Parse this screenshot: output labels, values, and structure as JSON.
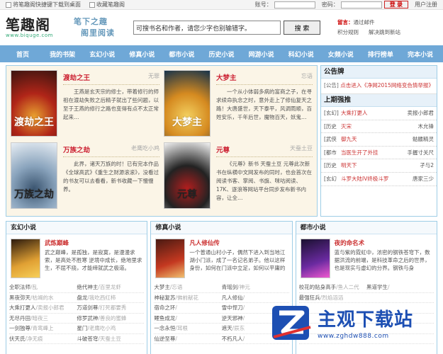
{
  "topbar": {
    "bookmark_text": "将笔趣阁快捷键下载到桌面",
    "favorite_text": "收藏笔趣阁",
    "account_label": "账号：",
    "password_label": "密码：",
    "login_label": "登 录",
    "user_register": "用户注册"
  },
  "header": {
    "logo_cn": "笔趣阁",
    "logo_en": "www.biquge.com",
    "slogan_line1": "笔下之趣",
    "slogan_line2": "阁里阅读",
    "search_value": "可搜书名和作者，请您少字也别输错字。",
    "search_button": "搜 索",
    "notice_label": "留言：",
    "notice_link": "通过邮件",
    "notice_link2": "积分规则",
    "notice_link3": "解决跳到新站"
  },
  "nav": [
    "首页",
    "我的书架",
    "玄幻小说",
    "修真小说",
    "都市小说",
    "历史小说",
    "网游小说",
    "科幻小说",
    "女频小说",
    "排行榜单",
    "完本小说"
  ],
  "featured": [
    {
      "name": "渡劫之王",
      "author": "无罪",
      "desc": "王燕是玄天宗的修士，带着修行的师祖在渡劫失败之后精子就出了些问题，以至于王燕的修行之路也变得有点不太正常起来…",
      "cover_title": "渡劫之王",
      "colors": [
        "#3b1410",
        "#b02518",
        "#e8a030"
      ]
    },
    {
      "name": "大梦主",
      "author": "忘语",
      "desc": "一个从小体弱多病的富商之子，在寻求续命执念之时，意外走上了修仙复天之路！大唐盛世，天下泰平，风调雨顺，百姓安乐，千年后世，魔物百天，妖鬼…",
      "cover_title": "大梦主",
      "colors": [
        "#15324a",
        "#d58a20",
        "#f3d060"
      ]
    },
    {
      "name": "万族之劫",
      "author": "老鹰吃小鸡",
      "desc": "此界，诸天万族的时！已有完本作品《全球高武》《重生之财源滚滚》，没看过的书友可以去看看，新书收藏一下慢慢养。",
      "cover_title": "万族之劫",
      "colors": [
        "#e8eef4",
        "#8aa4bd",
        "#3b5570"
      ]
    },
    {
      "name": "元尊",
      "author": "天蚕土豆",
      "desc": "《元尊》新书 天蚕土豆 元尊此次新书在纵横中文网发布的同时，也会首次在阅读书客、掌阅、书旗、咪咕阅读、17K、逐浪等网站平台同步发布新书内容，让全…",
      "cover_title": "元尊",
      "colors": [
        "#f2f2f2",
        "#222222",
        "#b31e1e"
      ]
    }
  ],
  "side": {
    "announcement_title": "公告牌",
    "announcement_text": "[公告]",
    "announcement_link": "点击进入《净网2015网络变色情举报》",
    "recommend_title": "上期强推",
    "items": [
      {
        "cat": "[玄幻]",
        "book": "大乘打更人",
        "author": "卖报小郎君"
      },
      {
        "cat": "[历史",
        "book": "灭宋",
        "author": "木允锋"
      },
      {
        "cat": "[武侠",
        "book": "御九天",
        "author": "骷髅精灵"
      },
      {
        "cat": "[都市",
        "book": "当医生开了外挂",
        "author": "手握寸关尺"
      },
      {
        "cat": "[历史",
        "book": "明天下",
        "author": "孑与2"
      },
      {
        "cat": "[玄幻",
        "book": "斗罗大陆IV终极斗罗",
        "author": "唐家三少"
      }
    ]
  },
  "sections": [
    {
      "title": "玄幻小说",
      "top_name": "武炼巅峰",
      "top_desc": "武之巅峰，是孤独，是寂寞，是漫漫求索，是高处不胜寒 逆境中成长，绝地里求生，不屈不挠，才能缔就武之极道。",
      "cover_colors": [
        "#2b1a0d",
        "#e0a033",
        "#f7d05a"
      ],
      "rows": [
        {
          "b1": "全职法师",
          "a1": "/乱",
          "b2": "绝代神主",
          "a2": "/百里龙虾"
        },
        {
          "b1": "黑夜弥天",
          "a1": "/枯竭的水",
          "b2": "盘龙",
          "a2": "/我吃西红柿"
        },
        {
          "b1": "大乘打更人",
          "a1": "/卖报小郎君",
          "b2": "万道剑尊",
          "a2": "/打死都要秀"
        },
        {
          "b1": "无尽丹田",
          "a1": "/暗夜三",
          "b2": "修罗武神",
          "a2": "/善良的蜜蜂"
        },
        {
          "b1": "一剑独尊",
          "a1": "/青鸾峰上",
          "b2": "星门",
          "a2": "/老鹰吃小鸡"
        },
        {
          "b1": "伏天氏",
          "a1": "/净无痕",
          "b2": "斗破苍穹",
          "a2": "/天蚕土豆"
        }
      ]
    },
    {
      "title": "修真小说",
      "top_name": "凡人修仙传",
      "top_desc": "一个普通山村小子，偶然下进入到当地江湖小门派，成了一名记名弟子。他以这样身份，如何在门派中立足，如何以平庸的",
      "cover_colors": [
        "#4a1a12",
        "#c43820",
        "#f0c070"
      ],
      "rows": [
        {
          "b1": "大梦主",
          "a1": "/忘语",
          "b2": "青瑶剑",
          "a2": "/神元"
        },
        {
          "b1": "神秘复苏",
          "a1": "/佛前献花",
          "b2": "凡人修仙",
          "a2": "/"
        },
        {
          "b1": "宿命之环",
          "a1": "/",
          "b2": "雪中悍刀",
          "a2": "/"
        },
        {
          "b1": "鲤鱼成龙",
          "a1": "/",
          "b2": "逆天邪神",
          "a2": "/"
        },
        {
          "b1": "一念永恒",
          "a1": "/耳根",
          "b2": "遮天",
          "a2": "/辰东"
        },
        {
          "b1": "仙逆至尊",
          "a1": "/",
          "b2": "不朽凡人",
          "a2": "/"
        }
      ]
    },
    {
      "title": "都市小说",
      "top_name": "夜的命名术",
      "top_desc": "蓝与紫的霓虹中，浓密的钢铁苍穹下，数据洪流的前端，是科技革命之后的世界，也是现实与虚幻的分界。钢铁与身",
      "cover_colors": [
        "#1a1030",
        "#6a2aa0",
        "#f05ad0"
      ],
      "rows": [
        {
          "b1": "校花的贴身高手",
          "a1": "/鱼人二代",
          "b2": "黑道学生",
          "a2": "/"
        },
        {
          "b1": "最强狂兵",
          "a1": "/烈焰滔滔",
          "b2": "",
          "a2": ""
        },
        {
          "b1": "",
          "a1": "",
          "b2": "",
          "a2": ""
        },
        {
          "b1": "",
          "a1": "",
          "b2": "",
          "a2": ""
        },
        {
          "b1": "",
          "a1": "",
          "b2": "",
          "a2": ""
        },
        {
          "b1": "",
          "a1": "",
          "b2": "",
          "a2": ""
        }
      ]
    }
  ],
  "watermark": {
    "brand": "主观下载站",
    "url": "www.zghdw888.com",
    "color": "#1d4fb3"
  }
}
